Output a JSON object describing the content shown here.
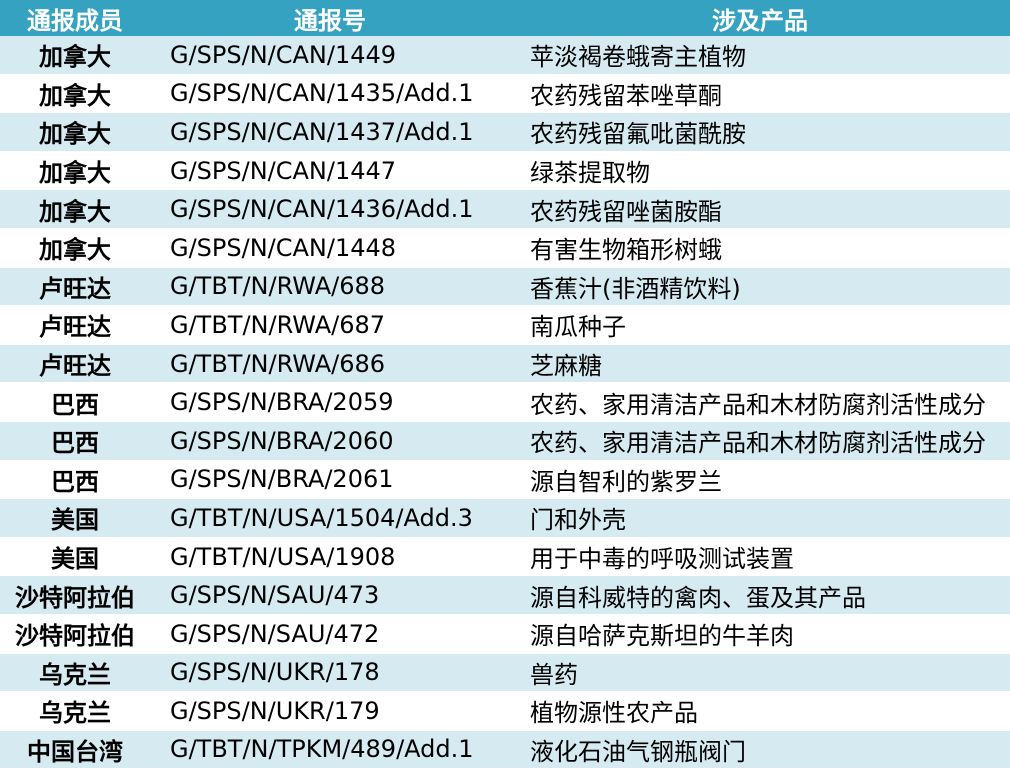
{
  "header": {
    "member": "通报成员",
    "number": "通报号",
    "product": "涉及产品"
  },
  "rows": [
    {
      "member": "加拿大",
      "number": "G/SPS/N/CAN/1449",
      "product": "苹淡褐卷蛾寄主植物"
    },
    {
      "member": "加拿大",
      "number": "G/SPS/N/CAN/1435/Add.1",
      "product": "农药残留苯唑草酮"
    },
    {
      "member": "加拿大",
      "number": "G/SPS/N/CAN/1437/Add.1",
      "product": "农药残留氟吡菌酰胺"
    },
    {
      "member": "加拿大",
      "number": "G/SPS/N/CAN/1447",
      "product": "绿茶提取物"
    },
    {
      "member": "加拿大",
      "number": "G/SPS/N/CAN/1436/Add.1",
      "product": "农药残留唑菌胺酯"
    },
    {
      "member": "加拿大",
      "number": "G/SPS/N/CAN/1448",
      "product": "有害生物箱形树蛾"
    },
    {
      "member": "卢旺达",
      "number": "G/TBT/N/RWA/688",
      "product": "香蕉汁(非酒精饮料)"
    },
    {
      "member": "卢旺达",
      "number": "G/TBT/N/RWA/687",
      "product": "南瓜种子"
    },
    {
      "member": "卢旺达",
      "number": "G/TBT/N/RWA/686",
      "product": "芝麻糖"
    },
    {
      "member": "巴西",
      "number": "G/SPS/N/BRA/2059",
      "product": "农药、家用清洁产品和木材防腐剂活性成分"
    },
    {
      "member": "巴西",
      "number": "G/SPS/N/BRA/2060",
      "product": "农药、家用清洁产品和木材防腐剂活性成分"
    },
    {
      "member": "巴西",
      "number": "G/SPS/N/BRA/2061",
      "product": "源自智利的紫罗兰"
    },
    {
      "member": "美国",
      "number": "G/TBT/N/USA/1504/Add.3",
      "product": "门和外壳"
    },
    {
      "member": "美国",
      "number": "G/TBT/N/USA/1908",
      "product": "用于中毒的呼吸测试装置"
    },
    {
      "member": "沙特阿拉伯",
      "number": "G/SPS/N/SAU/473",
      "product": "源自科威特的禽肉、蛋及其产品"
    },
    {
      "member": "沙特阿拉伯",
      "number": "G/SPS/N/SAU/472",
      "product": "源自哈萨克斯坦的牛羊肉"
    },
    {
      "member": "乌克兰",
      "number": "G/SPS/N/UKR/178",
      "product": "兽药"
    },
    {
      "member": "乌克兰",
      "number": "G/SPS/N/UKR/179",
      "product": "植物源性农产品"
    },
    {
      "member": "中国台湾",
      "number": "G/TBT/N/TPKM/489/Add.1",
      "product": "液化石油气钢瓶阀门"
    }
  ]
}
